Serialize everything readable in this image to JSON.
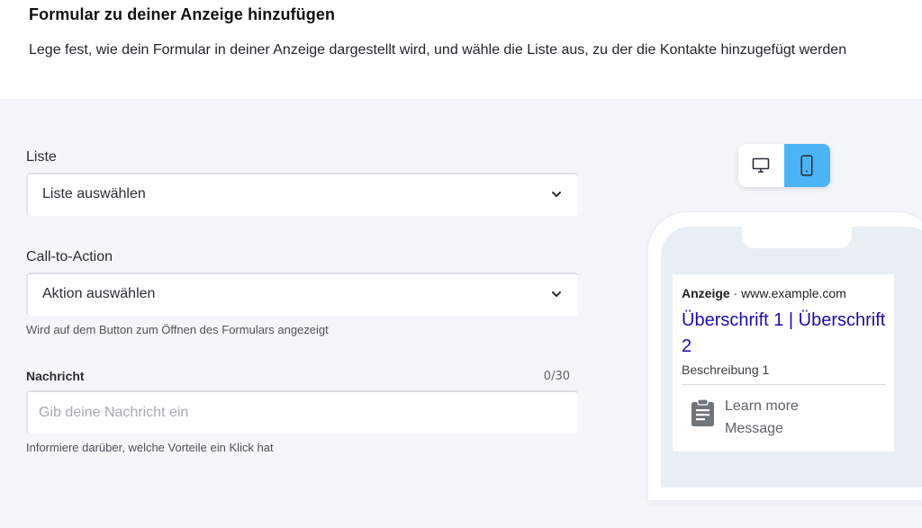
{
  "header": {
    "title": "Formular zu deiner Anzeige hinzufügen",
    "subtitle": "Lege fest, wie dein Formular in deiner Anzeige dargestellt wird, und wähle die Liste aus, zu der die Kontakte hinzugefügt werden"
  },
  "form": {
    "list": {
      "label": "Liste",
      "value": "Liste auswählen"
    },
    "cta": {
      "label": "Call-to-Action",
      "value": "Aktion auswählen",
      "hint": "Wird auf dem Button zum Öffnen des Formulars angezeigt"
    },
    "message": {
      "label": "Nachricht",
      "counter": "0/30",
      "placeholder": "Gib deine Nachricht ein",
      "hint": "Informiere darüber, welche Vorteile ein Klick hat"
    }
  },
  "preview": {
    "toggle": {
      "options": [
        "desktop-icon",
        "mobile-icon"
      ],
      "selected": "mobile",
      "accent": "#4db3f7"
    },
    "ad": {
      "label": "Anzeige",
      "separator": "·",
      "url": "www.example.com",
      "headline": "Überschrift 1 | Überschrift 2",
      "description": "Beschreibung 1",
      "cta_line1": "Learn more",
      "cta_line2": "Message",
      "cta_icon": "clipboard-icon"
    }
  },
  "colors": {
    "headline_link": "#1a0dab",
    "background": "#f5f6fa"
  }
}
